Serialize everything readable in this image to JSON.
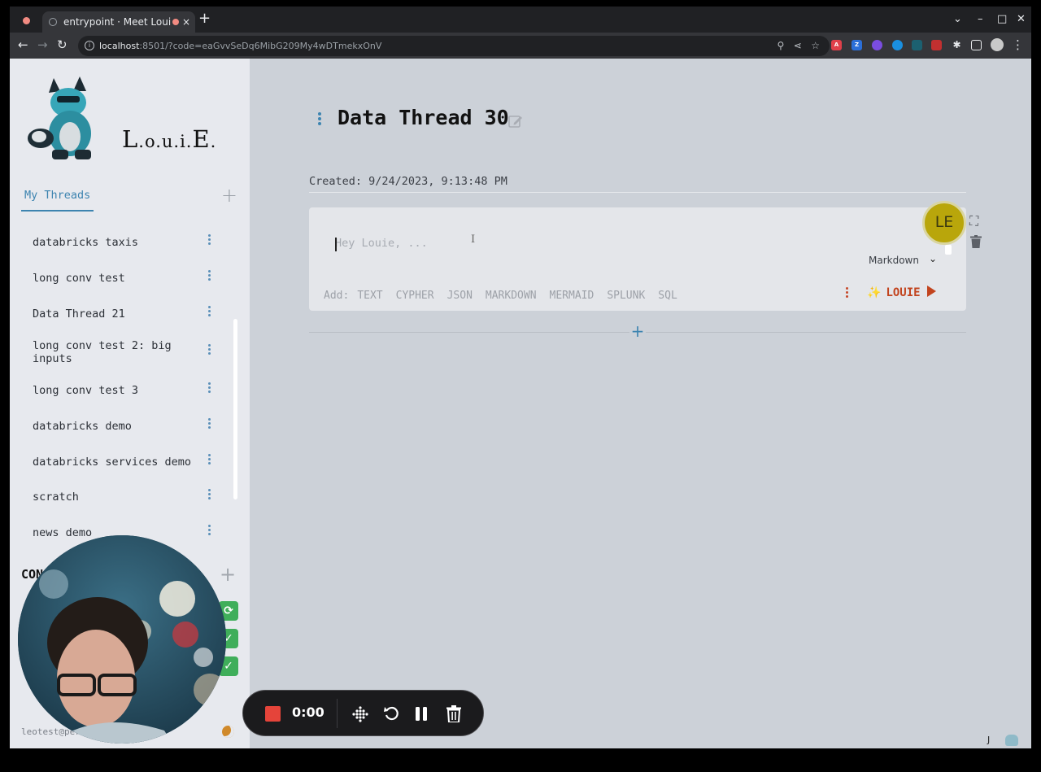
{
  "browser": {
    "tab_title": "entrypoint · Meet Loui",
    "url_host": "localhost",
    "url_path": ":8501/?code=eaGvvSeDq6MibG209My4wDTmekxOnV",
    "new_tab": "+",
    "tab_close": "×"
  },
  "sidebar": {
    "brand": {
      "big1": "L",
      "small1": ".o.u.i.",
      "big2": "E",
      "small2": "."
    },
    "tabs": {
      "my_threads": "My Threads",
      "add": "+"
    },
    "threads": [
      {
        "label": "databricks taxis"
      },
      {
        "label": "long conv test"
      },
      {
        "label": "Data Thread 21"
      },
      {
        "label": "long conv test 2: big inputs"
      },
      {
        "label": "long conv test 3"
      },
      {
        "label": "databricks demo"
      },
      {
        "label": "databricks services demo"
      },
      {
        "label": "scratch"
      },
      {
        "label": "news demo"
      }
    ],
    "connections_title": "CON",
    "connections_add": "+",
    "user_line": "leotest@per"
  },
  "main": {
    "title": "Data Thread 30",
    "created": "Created: 9/24/2023, 9:13:48 PM",
    "cell": {
      "placeholder": "Hey Louie, ...",
      "mode": "Markdown",
      "add_label": "Add:",
      "add_options": [
        "TEXT",
        "CYPHER",
        "JSON",
        "MARKDOWN",
        "MERMAID",
        "SPLUNK",
        "SQL"
      ],
      "run_label": "LOUIE",
      "avatar": "LE"
    },
    "add_cell": "+",
    "footer_j": "J"
  },
  "recorder": {
    "time": "0:00"
  },
  "colors": {
    "accent": "#3d84b0",
    "run": "#c2441e",
    "avatar": "#b9a60b",
    "connection_ok": "#3fae5a",
    "recorder_stop": "#e5443a"
  }
}
